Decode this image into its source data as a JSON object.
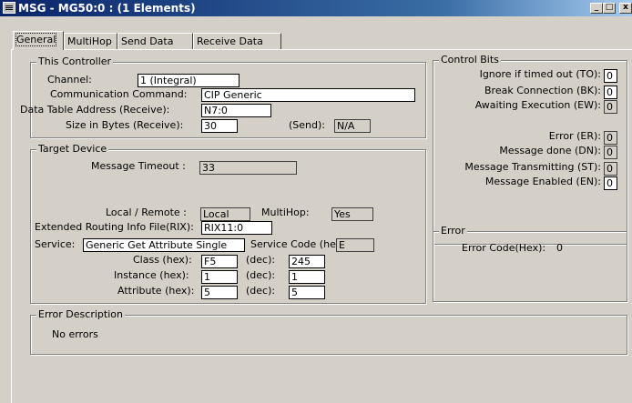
{
  "window": {
    "title": "MSG - MG50:0 : (1 Elements)",
    "min_btn": "_",
    "max_btn": "□",
    "close_btn": "x"
  },
  "tabs": [
    {
      "label": "General",
      "active": true
    },
    {
      "label": "MultiHop"
    },
    {
      "label": "Send Data"
    },
    {
      "label": "Receive Data"
    }
  ],
  "this_controller": {
    "title": "This Controller",
    "channel_label": "Channel:",
    "channel_value": "1 (Integral)",
    "command_label": "Communication Command:",
    "command_value": "CIP Generic",
    "address_label": "Data Table Address (Receive):",
    "address_value": "N7:0",
    "size_label": "Size in Bytes (Receive):",
    "size_value": "30",
    "send_label": "(Send):",
    "send_value": "N/A"
  },
  "target_device": {
    "title": "Target Device",
    "timeout_label": "Message Timeout :",
    "timeout_value": "33",
    "local_remote_label": "Local / Remote :",
    "local_remote_value": "Local",
    "multihop_label": "MultiHop:",
    "multihop_value": "Yes",
    "rix_label": "Extended Routing Info File(RIX):",
    "rix_value": "RIX11:0",
    "service_label": "Service:",
    "service_value": "Generic Get Attribute Single",
    "service_code_label": "Service Code (hex):",
    "service_code_value": "E",
    "class_label": "Class (hex):",
    "class_hex": "F5",
    "class_dec_label": "(dec):",
    "class_dec": "245",
    "instance_label": "Instance (hex):",
    "instance_hex": "1",
    "instance_dec_label": "(dec):",
    "instance_dec": "1",
    "attribute_label": "Attribute (hex):",
    "attribute_hex": "5",
    "attribute_dec_label": "(dec):",
    "attribute_dec": "5"
  },
  "control_bits": {
    "title": "Control Bits",
    "to_label": "Ignore if timed out (TO):",
    "to_value": "0",
    "bk_label": "Break Connection (BK):",
    "bk_value": "0",
    "ew_label": "Awaiting Execution (EW):",
    "ew_value": "0",
    "er_label": "Error (ER):",
    "er_value": "0",
    "dn_label": "Message done (DN):",
    "dn_value": "0",
    "st_label": "Message Transmitting (ST):",
    "st_value": "0",
    "en_label": "Message Enabled (EN):",
    "en_value": "0"
  },
  "error": {
    "title": "Error",
    "code_label": "Error Code(Hex):",
    "code_value": "0"
  },
  "error_description": {
    "title": "Error Description",
    "text": "No errors"
  }
}
